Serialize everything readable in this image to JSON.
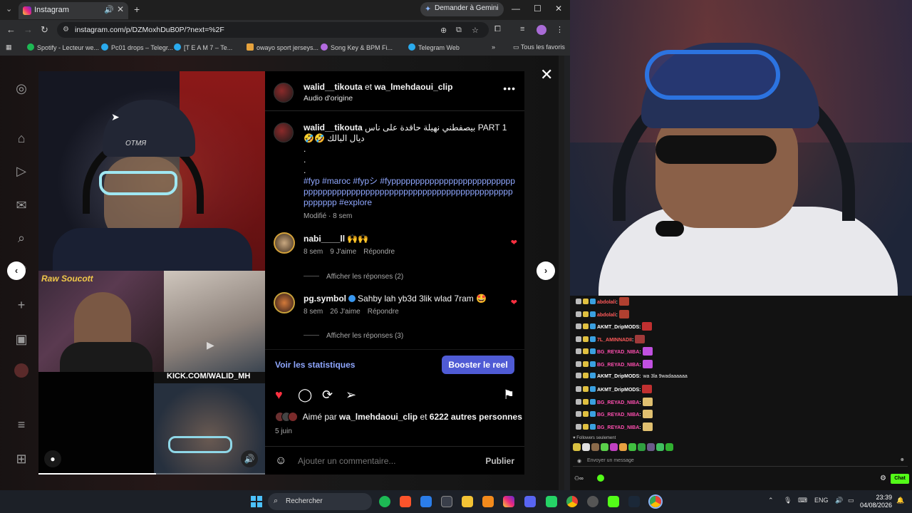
{
  "browser": {
    "tab_title": "Instagram",
    "gemini_label": "Demander à Gemini",
    "url": "instagram.com/p/DZMoxhDuB0P/?next=%2F",
    "bookmarks": [
      "Spotify - Lecteur we...",
      "Pc01 drops – Telegr...",
      "[T E A M 7 – Te...",
      "owayo sport jerseys...",
      "Song Key & BPM Fi...",
      "Telegram Web"
    ],
    "all_bookmarks": "Tous les favoris"
  },
  "post": {
    "author": "walid__tikouta",
    "connector": "et",
    "coauthor": "wa_lmehdaoui_clip",
    "audio": "Audio d'origine",
    "caption_user": "walid__tikouta",
    "caption_text": "PART 1 بيصفطني نهيلة حاقدة على ناس ديال البالك 🤣🤣",
    "caption_dots": [
      ".",
      ".",
      "."
    ],
    "hashtags": "#fyp #maroc #fypシ #fyppppppppppppppppppppppppppppppppppppppppppppppppppppppppppppppppppppppppppppp #explore",
    "caption_meta": "Modifié · 8 sem",
    "comments": [
      {
        "user": "nabi____ll",
        "text": "🙌🙌",
        "age": "8 sem",
        "likes": "9 J'aime",
        "reply": "Répondre",
        "replies": "Afficher les réponses (2)"
      },
      {
        "user": "pg.symbol",
        "text": "Sahby lah yb3d 3lik wlad 7ram 🤩",
        "age": "8 sem",
        "likes": "26 J'aime",
        "reply": "Répondre",
        "replies": "Afficher les réponses (3)"
      }
    ],
    "stats_link": "Voir les statistiques",
    "boost_button": "Booster le reel",
    "liked_prefix": "Aimé par",
    "liked_user": "wa_lmehdaoui_clip",
    "liked_connector": "et",
    "liked_others": "6222 autres personnes",
    "date": "5 juin",
    "comment_placeholder": "Ajouter un commentaire...",
    "publish": "Publier",
    "video_banner": "KICK.COM/WALID_MH",
    "video_logo": "Raw Soucott",
    "progress_fraction": 0.52
  },
  "chat": {
    "lines": [
      {
        "user": "abdolali",
        "msg": "",
        "color": "#ff5a5a"
      },
      {
        "user": "abdolali",
        "msg": "",
        "color": "#ff5a5a"
      },
      {
        "user": "AKMT_DripMODS",
        "msg": "",
        "color": "#ffffff"
      },
      {
        "user": "7L_AMINNADII",
        "msg": "",
        "color": "#ff5a5a"
      },
      {
        "user": "BG_REYAD_NIBA",
        "msg": "",
        "color": "#ff4fb0"
      },
      {
        "user": "BG_REYAD_NIBA",
        "msg": "",
        "color": "#ff4fb0"
      },
      {
        "user": "AKMT_DripMODS",
        "msg": "wa 3la 9wadaaaaaa",
        "color": "#ffffff"
      },
      {
        "user": "AKMT_DripMODS",
        "msg": "",
        "color": "#ffffff"
      },
      {
        "user": "BG_REYAD_NIBA",
        "msg": "",
        "color": "#ff4fb0"
      },
      {
        "user": "BG_REYAD_NIBA",
        "msg": "",
        "color": "#ff4fb0"
      },
      {
        "user": "BG_REYAD_NIBA",
        "msg": "",
        "color": "#ff4fb0"
      }
    ],
    "followers_only": "Followers seulement",
    "send_placeholder": "Envoyer un message",
    "chat_button": "Chat"
  },
  "taskbar": {
    "search": "Rechercher",
    "lang": "ENG",
    "time": "23:39",
    "date": "04/08/2026"
  },
  "colors": {
    "accent": "#4f5bd5",
    "heart": "#ff3040",
    "link": "#8fa7ff",
    "kick": "#53fc18"
  }
}
